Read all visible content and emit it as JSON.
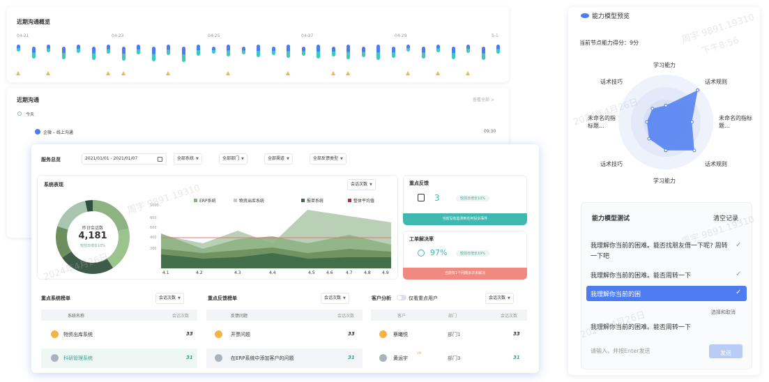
{
  "back_panel": {
    "overview_title": "近期沟通概览",
    "timeline_dates": [
      "04-21",
      "04-23",
      "04-25",
      "04-27",
      "04-29",
      "5-1"
    ],
    "recent_title": "近期沟通",
    "view_all": "查看全部 >",
    "today": "今天",
    "item_text": "企微 – 线上沟通",
    "item_time": "09:30"
  },
  "filters": {
    "label": "服务总览",
    "date_range": "2021/01/01 - 2021/01/07",
    "system": "全部系统",
    "dept": "全部部门",
    "channel": "全部渠道",
    "feedback_type": "全部反馈类型"
  },
  "system_perf": {
    "title": "系统表现",
    "dropdown": "会话次数",
    "donut_label": "昨日会话数",
    "donut_value": "4,181",
    "donut_sub": "较前日增长10%",
    "legend": [
      "ERP系统",
      "物资出库系统",
      "报单系统",
      "整体平均值"
    ],
    "y_ticks": [
      "1000",
      "800",
      "600",
      "400",
      "200"
    ],
    "x_ticks": [
      "4.1",
      "4.2",
      "4.3",
      "4.4",
      "4.5",
      "4.6",
      "4.7",
      "4.8",
      "4.9"
    ]
  },
  "key_feedback": {
    "title": "重点反馈",
    "value": "3",
    "badge": "较前日增长10%",
    "bar": "当前没有监测到任何投诉事件"
  },
  "resolution": {
    "title": "工单解决率",
    "value": "97%",
    "badge": "较前日增长10%",
    "bar": "当前有1个问题多次未解决"
  },
  "sys_rank": {
    "title": "重点系统榜单",
    "dropdown": "会话次数",
    "col1": "系统名称",
    "col2": "会话次数",
    "rows": [
      {
        "name": "物资出库系统",
        "count": "33"
      },
      {
        "name": "科研管理系统",
        "count": "31"
      }
    ]
  },
  "fb_rank": {
    "title": "重点反馈榜单",
    "dropdown": "会话次数",
    "col1": "反馈问题",
    "col2": "会话次数",
    "rows": [
      {
        "name": "开票问题",
        "count": "33"
      },
      {
        "name": "在ERP系统中添加客户的问题",
        "count": "31"
      }
    ]
  },
  "cust": {
    "title": "客户分析",
    "toggle": "仅看重点用户",
    "dropdown": "会话次数",
    "col1": "客户",
    "col2": "部门",
    "col3": "会话次数",
    "rows": [
      {
        "name": "蔡曦悦",
        "dept": "部门1",
        "count": "33"
      },
      {
        "name": "黄运宇",
        "dept": "部门3",
        "count": "31",
        "tag": "VIP"
      }
    ]
  },
  "ability": {
    "title": "能力模型预览",
    "score": "当前节点能力得分：9分",
    "labels": [
      "学习能力",
      "话术规则",
      "未命名的指标题…",
      "话术规则",
      "学习能力",
      "话术技巧",
      "未命名的指标题…",
      "话术技巧"
    ],
    "radar_values": [
      0.35,
      0.95,
      0.55,
      0.85,
      0.6,
      0.5,
      0.4,
      0.4
    ]
  },
  "test": {
    "title": "能力模型测试",
    "clear": "清空记录",
    "msg1": "我理解你当前的困难。能否找朋友借一下呢? 周转一下吧",
    "msg2": "我理解你当前的困难。能否周转一下",
    "msg3": "我理解你当前的困",
    "select_cancel": "选择和取消",
    "msg4": "我理解你当前的困难。能否周转一下",
    "input_placeholder": "请输入，并按Enter发送",
    "send": "发送"
  },
  "watermarks": [
    "周宇 9891.19310",
    "下午8:56",
    "2024年4月26日"
  ],
  "colors": {
    "blue": "#4d7cf0",
    "teal": "#3fb8b0",
    "green": "#5f8f6a",
    "red": "#f08a80"
  }
}
